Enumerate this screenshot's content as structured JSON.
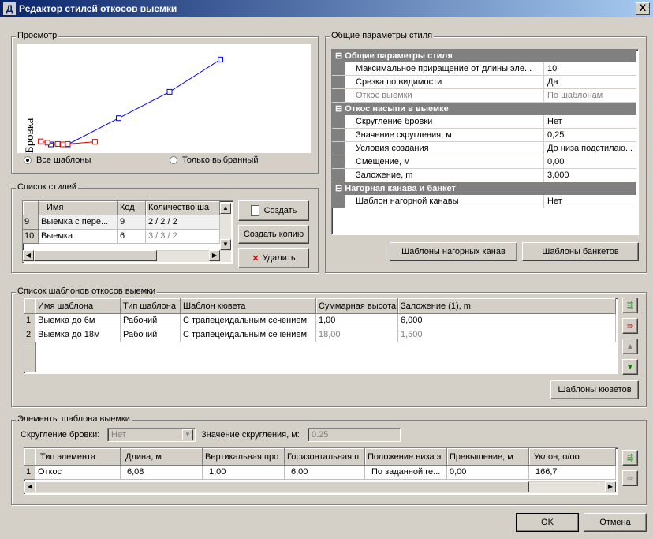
{
  "window": {
    "title": "Редактор стилей откосов выемки",
    "icon_letter": "Д",
    "close_label": "X"
  },
  "preview": {
    "group_label": "Просмотр",
    "axis_label": "Бровка",
    "radio_all": "Все шаблоны",
    "radio_selected": "Только выбранный",
    "selected": "all",
    "blue_line": [
      [
        -1,
        0
      ],
      [
        0,
        0
      ],
      [
        3,
        3
      ],
      [
        6,
        6
      ],
      [
        9,
        9.7
      ]
    ],
    "red_line": [
      [
        -1.6,
        0.35
      ],
      [
        -1.2,
        0.2
      ],
      [
        -0.6,
        0.05
      ],
      [
        -0.3,
        0
      ],
      [
        0,
        0.05
      ],
      [
        1.6,
        0.3
      ]
    ]
  },
  "styles": {
    "group_label": "Список стилей",
    "columns": [
      "Имя",
      "Код",
      "Количество ша"
    ],
    "rows": [
      {
        "num": "9",
        "name": "Выемка с пере...",
        "code": "9",
        "count": "2 / 2 / 2"
      },
      {
        "num": "10",
        "name": "Выемка",
        "code": "6",
        "count": "3 / 3 / 2"
      }
    ],
    "btn_create": "Создать",
    "btn_copy": "Создать копию",
    "btn_delete": "Удалить"
  },
  "params": {
    "group_label": "Общие параметры стиля",
    "sections": [
      {
        "title": "Общие параметры стиля",
        "rows": [
          {
            "name": "Максимальное приращение от длины эле...",
            "value": "10",
            "disabled": false
          },
          {
            "name": "Срезка по видимости",
            "value": "Да",
            "disabled": false
          },
          {
            "name": "Откос выемки",
            "value": "По шаблонам",
            "disabled": true
          }
        ]
      },
      {
        "title": "Откос насыпи в выемке",
        "rows": [
          {
            "name": "Скругление бровки",
            "value": "Нет",
            "disabled": false
          },
          {
            "name": "Значение скругления, м",
            "value": "0,25",
            "disabled": false
          },
          {
            "name": "Условия создания",
            "value": "До низа подстилаю...",
            "disabled": false
          },
          {
            "name": "Смещение, м",
            "value": "0,00",
            "disabled": false
          },
          {
            "name": "Заложение, m",
            "value": "3,000",
            "disabled": false
          }
        ]
      },
      {
        "title": "Нагорная канава и банкет",
        "rows": [
          {
            "name": "Шаблон нагорной канавы",
            "value": "Нет",
            "disabled": false
          }
        ]
      }
    ],
    "btn_ditch": "Шаблоны нагорных канав",
    "btn_bench": "Шаблоны банкетов"
  },
  "templates": {
    "group_label": "Список шаблонов откосов выемки",
    "columns": [
      "Имя шаблона",
      "Тип шаблона",
      "Шаблон кювета",
      "Суммарная высота",
      "Заложение (1), m"
    ],
    "rows": [
      {
        "num": "1",
        "name": "Выемка до 6м",
        "type": "Рабочий",
        "ditch": "С трапецеидальным сечением",
        "height": "1,00",
        "slope": "6,000",
        "gray": false
      },
      {
        "num": "2",
        "name": "Выемка до 18м",
        "type": "Рабочий",
        "ditch": "С трапецеидальным сечением",
        "height": "18,00",
        "slope": "1,500",
        "gray": true
      }
    ],
    "btn_ditch_templates": "Шаблоны кюветов"
  },
  "elements": {
    "group_label": "Элементы шаблона выемки",
    "rounding_label": "Скругление бровки:",
    "rounding_value": "Нет",
    "round_value_label": "Значение скругления, м:",
    "round_value": "0.25",
    "columns": [
      "Тип элемента",
      "Длина, м",
      "Вертикальная про",
      "Горизонтальная п",
      "Положение низа э",
      "Превышение, м",
      "Уклон, о/оо"
    ],
    "row": {
      "num": "1",
      "type": "Откос",
      "length": "6,08",
      "vert": "1,00",
      "horiz": "6,00",
      "bottom": "По заданной ге...",
      "excess": "0,00",
      "slope": "166,7"
    }
  },
  "dialog": {
    "ok": "OK",
    "cancel": "Отмена"
  },
  "colors": {
    "title_start": "#0a246a",
    "title_end": "#a6caf0",
    "face": "#d4d0c8",
    "section": "#808080",
    "blue": "#0000ff",
    "red": "#e00000"
  }
}
